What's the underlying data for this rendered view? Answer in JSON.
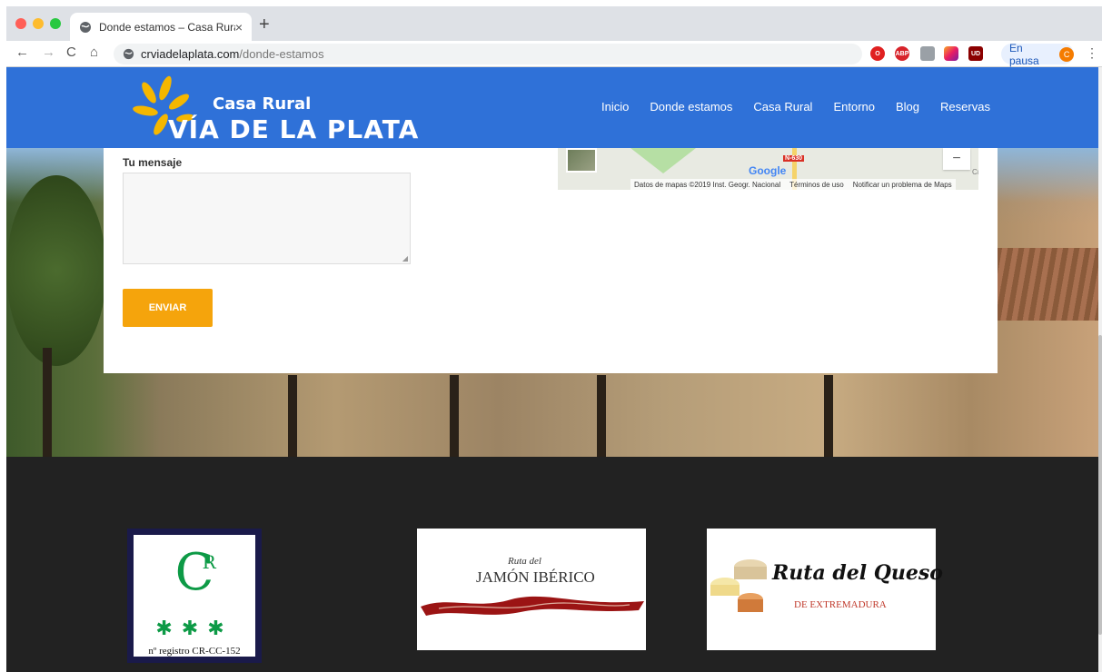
{
  "browser": {
    "tab_title": "Donde estamos – Casa Rural",
    "tab_close": "×",
    "new_tab": "+",
    "url_host": "crviadelaplata.com",
    "url_path": "/donde-estamos",
    "back": "←",
    "forward": "→",
    "reload": "C",
    "home": "⌂",
    "profile_status": "En pausa",
    "profile_initial": "C",
    "menu": "⋮",
    "extensions": [
      "opera-icon",
      "adblock-plus-icon",
      "chat-icon",
      "instagram-icon",
      "ublock-icon"
    ],
    "ext_abp": "ABP",
    "ext_ublock": "UD",
    "traffic_colors": [
      "#ff5f57",
      "#febc2e",
      "#28c840"
    ]
  },
  "site": {
    "logo_line1": "Casa Rural",
    "logo_line2": "VÍA DE LA PLATA",
    "nav": [
      "Inicio",
      "Donde estamos",
      "Casa Rural",
      "Entorno",
      "Blog",
      "Reservas"
    ],
    "header_color": "#2f71d8"
  },
  "form": {
    "message_label": "Tu mensaje",
    "message_value": "",
    "submit_label": "ENVIAR",
    "accent": "#f5a40c"
  },
  "map": {
    "road_label": "N-630",
    "google": "Google",
    "zoom_out": "−",
    "edge_label": "Cı",
    "attribution": "Datos de mapas ©2019 Inst. Geogr. Nacional",
    "terms": "Términos de uso",
    "report": "Notificar un problema de Maps"
  },
  "footer": {
    "badge_cr_letters": "C",
    "badge_cr_sup": "R",
    "badge_cr_stars": "✱✱✱",
    "badge_cr_registry": "nº registro CR-CC-152",
    "jamon_small": "Ruta del",
    "jamon_big": "JAMÓN IBÉRICO",
    "queso_script": "Ruta del Queso",
    "queso_sub": "DE EXTREMADURA"
  }
}
